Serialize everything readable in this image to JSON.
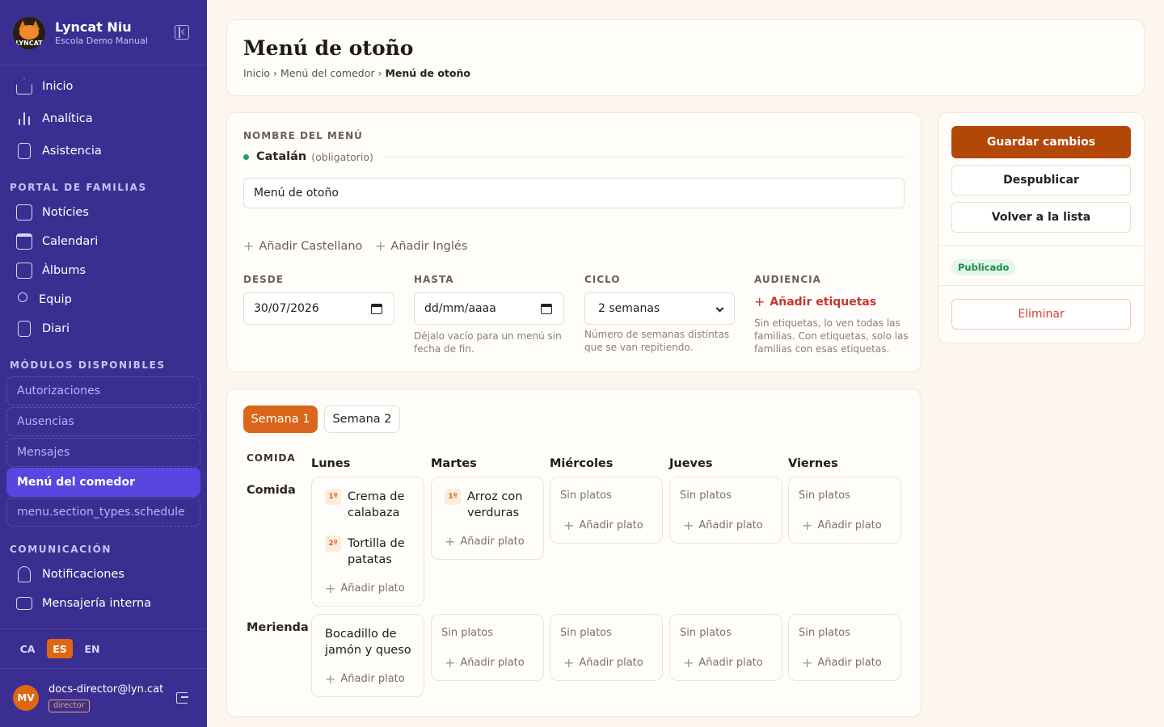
{
  "brand": {
    "name": "Lyncat Niu",
    "subtitle": "Escola Demo Manual",
    "logo_text": "LYNCAT"
  },
  "nav": {
    "main": [
      {
        "label": "Inicio",
        "icon": "home-icon"
      },
      {
        "label": "Analítica",
        "icon": "bar-chart-icon"
      },
      {
        "label": "Asistencia",
        "icon": "clipboard-check-icon"
      }
    ],
    "families_title": "PORTAL DE FAMILIAS",
    "families": [
      {
        "label": "Notícies",
        "icon": "newspaper-icon"
      },
      {
        "label": "Calendari",
        "icon": "calendar-icon"
      },
      {
        "label": "Àlbums",
        "icon": "image-icon"
      },
      {
        "label": "Equip",
        "icon": "users-icon"
      },
      {
        "label": "Diari",
        "icon": "clipboard-icon"
      }
    ],
    "modules_title": "MÓDULOS DISPONIBLES",
    "modules": [
      "Autorizaciones",
      "Ausencias",
      "Mensajes",
      "Menú del comedor",
      "menu.section_types.schedule"
    ],
    "comm_title": "COMUNICACIÓN",
    "comm": [
      {
        "label": "Notificaciones",
        "icon": "bell-icon"
      },
      {
        "label": "Mensajería interna",
        "icon": "chat-icon"
      }
    ]
  },
  "languages": [
    "CA",
    "ES",
    "EN"
  ],
  "active_language": "ES",
  "user": {
    "initials": "MV",
    "email": "docs-director@lyn.cat",
    "role": "director"
  },
  "header": {
    "title": "Menú de otoño",
    "breadcrumb": [
      "Inicio",
      "Menú del comedor",
      "Menú de otoño"
    ]
  },
  "form": {
    "name_label": "NOMBRE DEL MENÚ",
    "lang_name": "Catalán",
    "lang_required": "(obligatorio)",
    "name_value": "Menú de otoño",
    "add_castellano": "Añadir Castellano",
    "add_ingles": "Añadir Inglés",
    "desde_label": "DESDE",
    "desde_value": "30/07/2026",
    "hasta_label": "HASTA",
    "hasta_placeholder": "dd/mm/aaaa",
    "hasta_help": "Déjalo vacío para un menú sin fecha de fin.",
    "ciclo_label": "CICLO",
    "ciclo_value": "2 semanas",
    "ciclo_help": "Número de semanas distintas que se van repitiendo.",
    "audiencia_label": "AUDIENCIA",
    "add_tags": "Añadir etiquetas",
    "audiencia_help": "Sin etiquetas, lo ven todas las familias. Con etiquetas, solo las familias con esas etiquetas."
  },
  "actions": {
    "save": "Guardar cambios",
    "unpublish": "Despublicar",
    "back": "Volver a la lista",
    "status": "Publicado",
    "delete": "Eliminar"
  },
  "week_tabs": [
    "Semana 1",
    "Semana 2"
  ],
  "grid": {
    "meal_header": "COMIDA",
    "days": [
      "Lunes",
      "Martes",
      "Miércoles",
      "Jueves",
      "Viernes"
    ],
    "empty_text": "Sin platos",
    "add_text": "Añadir plato",
    "meals": [
      {
        "name": "Comida",
        "cells": [
          [
            {
              "badge": "1º",
              "line1": "Crema de",
              "line2": "calabaza"
            },
            {
              "badge": "2º",
              "line1": "Tortilla de",
              "line2": "patatas"
            }
          ],
          [
            {
              "badge": "1º",
              "line1": "Arroz con",
              "line2": "verduras"
            }
          ],
          [],
          [],
          []
        ]
      },
      {
        "name": "Merienda",
        "cells": [
          [
            {
              "badge": "",
              "line1": "Bocadillo de",
              "line2": "jamón y queso"
            }
          ],
          [],
          [],
          [],
          []
        ]
      }
    ]
  },
  "colors": {
    "sidebar": "#3a2f91",
    "accent": "#e06610",
    "save": "#b34708",
    "danger": "#d93a3a",
    "status_bg": "#e3f6e8"
  }
}
